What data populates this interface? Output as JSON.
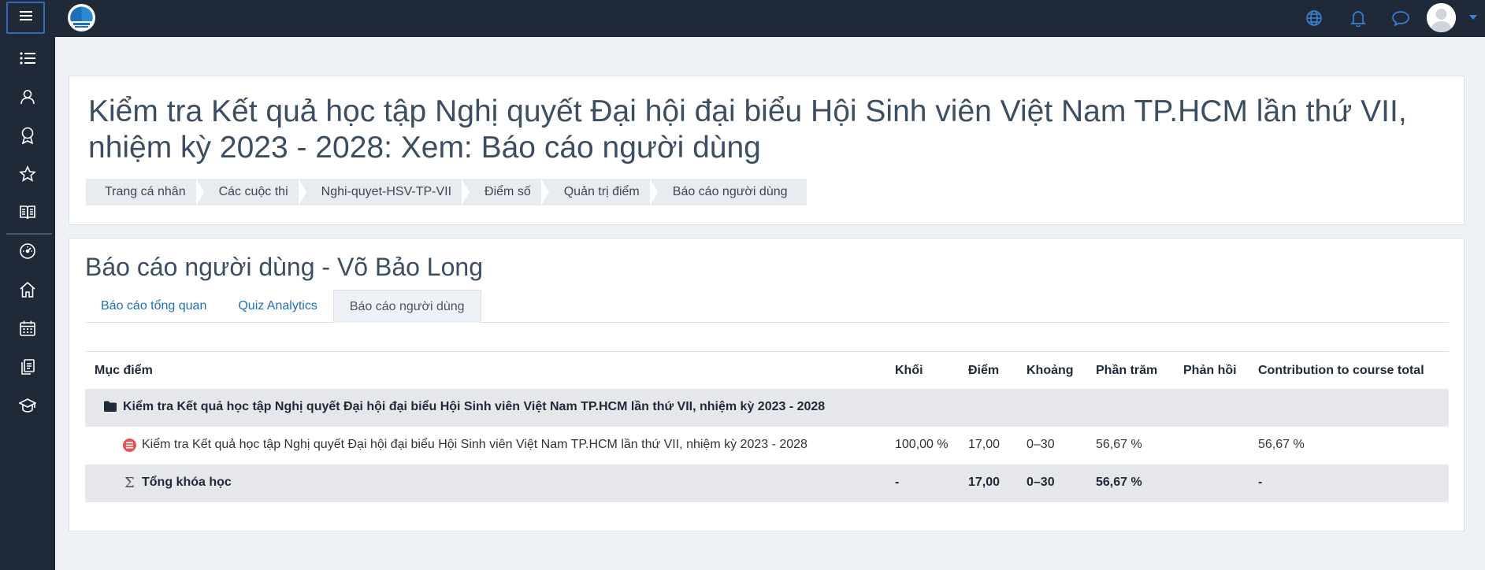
{
  "page": {
    "title": "Kiểm tra Kết quả học tập Nghị quyết Đại hội đại biểu Hội Sinh viên Việt Nam TP.HCM lần thứ VII, nhiệm kỳ 2023 - 2028: Xem: Báo cáo người dùng"
  },
  "breadcrumb": [
    "Trang cá nhân",
    "Các cuộc thi",
    "Nghi-quyet-HSV-TP-VII",
    "Điểm số",
    "Quản trị điểm",
    "Báo cáo người dùng"
  ],
  "report": {
    "title": "Báo cáo người dùng - Võ Bảo Long",
    "tabs": [
      "Báo cáo tổng quan",
      "Quiz Analytics",
      "Báo cáo người dùng"
    ],
    "active_tab": "Báo cáo người dùng",
    "columns": [
      "Mục điểm",
      "Khối",
      "Điểm",
      "Khoảng",
      "Phần trăm",
      "Phản hồi",
      "Contribution to course total"
    ],
    "category": {
      "name": "Kiểm tra Kết quả học tập Nghị quyết Đại hội đại biểu Hội Sinh viên Việt Nam TP.HCM lần thứ VII, nhiệm kỳ 2023 - 2028"
    },
    "item": {
      "name": "Kiểm tra Kết quả học tập Nghị quyết Đại hội đại biểu Hội Sinh viên Việt Nam TP.HCM lần thứ VII, nhiệm kỳ 2023 - 2028",
      "weight": "100,00 %",
      "grade": "17,00",
      "range": "0–30",
      "percentage": "56,67 %",
      "feedback": "",
      "contribution": "56,67 %"
    },
    "total": {
      "name": "Tổng khóa học",
      "weight": "-",
      "grade": "17,00",
      "range": "0–30",
      "percentage": "56,67 %",
      "feedback": "",
      "contribution": "-"
    }
  },
  "topbar_icons": [
    "menu-icon",
    "globe-icon",
    "bell-icon",
    "chat-icon",
    "user-avatar",
    "caret-down-icon"
  ],
  "sidenav_icons": [
    "list-icon",
    "user-icon",
    "badge-icon",
    "star-icon",
    "book-icon",
    "dashboard-icon",
    "home-icon",
    "calendar-icon",
    "files-icon",
    "graduation-cap-icon"
  ],
  "colors": {
    "topbar": "#1f2937",
    "accent": "#1f6fb8",
    "background": "#eef1f5"
  }
}
